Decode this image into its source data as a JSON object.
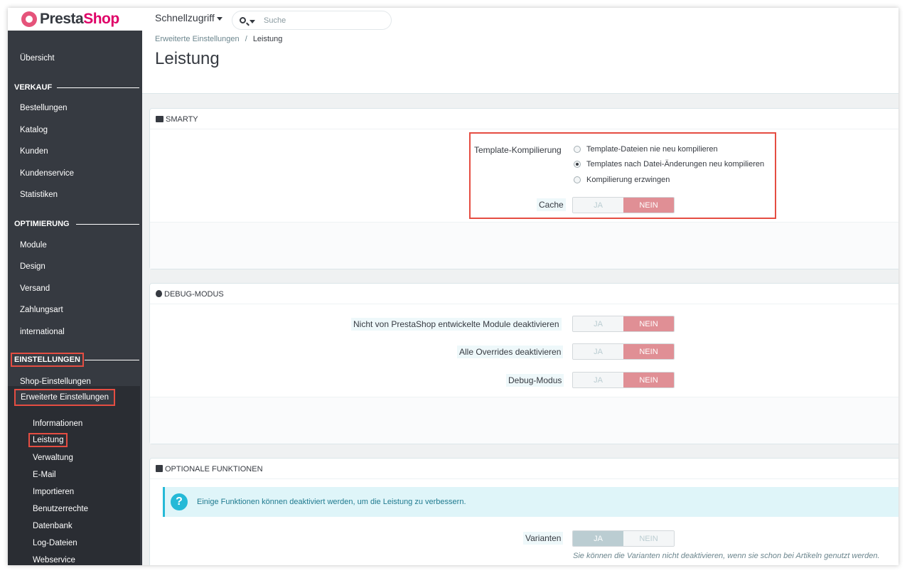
{
  "app": {
    "logo_presta": "Presta",
    "logo_shop": "Shop"
  },
  "header": {
    "quick_access": "Schnellzugriff",
    "search_placeholder": "Suche",
    "breadcrumb_parent": "Erweiterte Einstellungen",
    "breadcrumb_sep": "/",
    "breadcrumb_current": "Leistung",
    "page_title": "Leistung"
  },
  "sidebar": {
    "overview": "Übersicht",
    "sections": {
      "sales": "VERKAUF",
      "optimize": "OPTIMIERUNG",
      "settings": "EINSTELLUNGEN"
    },
    "sales_items": [
      "Bestellungen",
      "Katalog",
      "Kunden",
      "Kundenservice",
      "Statistiken"
    ],
    "optimize_items": [
      "Module",
      "Design",
      "Versand",
      "Zahlungsart",
      "international"
    ],
    "shop_settings": "Shop-Einstellungen",
    "advanced": "Erweiterte Einstellungen",
    "sub_items": [
      "Informationen",
      "Leistung",
      "Verwaltung",
      "E-Mail",
      "Importieren",
      "Benutzerrechte",
      "Datenbank",
      "Log-Dateien",
      "Webservice"
    ],
    "active_sub": "Leistung"
  },
  "smarty": {
    "title": "SMARTY",
    "template_label": "Template-Kompilierung",
    "options": [
      "Template-Dateien nie neu kompilieren",
      "Templates nach Datei-Änderungen neu kompilieren",
      "Kompilierung erzwingen"
    ],
    "selected_option": "Templates nach Datei-Änderungen neu kompilieren",
    "cache_label": "Cache",
    "cache_value": "NEIN"
  },
  "debug": {
    "title": "DEBUG-MODUS",
    "rows": [
      {
        "label": "Nicht von PrestaShop entwickelte Module deaktivieren",
        "value": "NEIN"
      },
      {
        "label": "Alle Overrides deaktivieren",
        "value": "NEIN"
      },
      {
        "label": "Debug-Modus",
        "value": "NEIN"
      }
    ]
  },
  "optional": {
    "title": "OPTIONALE FUNKTIONEN",
    "info": "Einige Funktionen können deaktiviert werden, um die Leistung zu verbessern.",
    "variants_label": "Varianten",
    "variants_value": "JA",
    "variants_help": "Sie können die Varianten nicht deaktivieren, wenn sie schon bei Artikeln genutzt werden."
  },
  "switch": {
    "yes": "JA",
    "no": "NEIN"
  },
  "colors": {
    "sidebar_bg": "#363a41",
    "highlight": "#e54d42",
    "switch_no_active": "#e08f95",
    "info_accent": "#25b9d7"
  }
}
